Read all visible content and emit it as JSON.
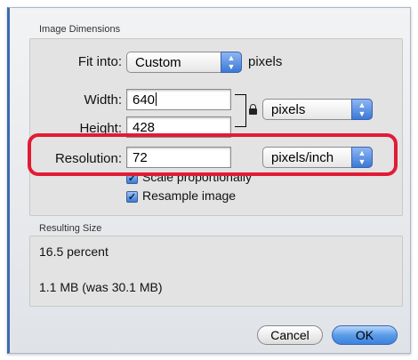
{
  "dialog": {
    "image_dimensions_title": "Image Dimensions",
    "fit_into_label": "Fit into:",
    "fit_into_value": "Custom",
    "fit_into_unit": "pixels",
    "width_label": "Width:",
    "width_value": "640",
    "height_label": "Height:",
    "height_value": "428",
    "size_unit_value": "pixels",
    "resolution_label": "Resolution:",
    "resolution_value": "72",
    "resolution_unit_value": "pixels/inch",
    "scale_proportionally_label": "Scale proportionally",
    "scale_proportionally_checked": true,
    "resample_image_label": "Resample image",
    "resample_image_checked": true,
    "resulting_size_title": "Resulting Size",
    "percent_text": "16.5 percent",
    "file_size_text": "1.1 MB (was 30.1 MB)",
    "cancel_label": "Cancel",
    "ok_label": "OK"
  },
  "icons": {
    "lock": "lock-icon",
    "popup_arrows": "updown-arrows-icon",
    "checkmark": "checkmark-icon"
  },
  "colors": {
    "highlight": "#e21b35",
    "default_button": "#3b82de",
    "window_edge": "#3b6ab0"
  }
}
